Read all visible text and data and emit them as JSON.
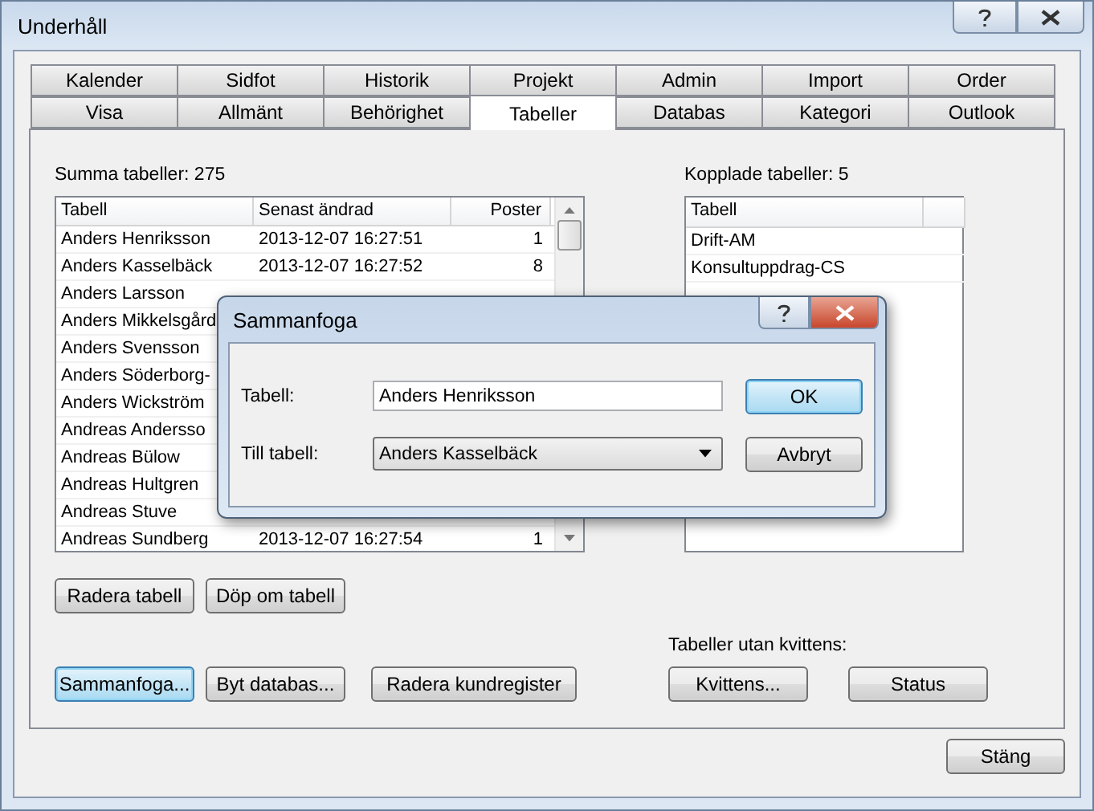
{
  "window": {
    "title": "Underhåll"
  },
  "tab_rows": [
    [
      {
        "label": "Kalender",
        "selected": false
      },
      {
        "label": "Sidfot",
        "selected": false
      },
      {
        "label": "Historik",
        "selected": false
      },
      {
        "label": "Projekt",
        "selected": false
      },
      {
        "label": "Admin",
        "selected": false
      },
      {
        "label": "Import",
        "selected": false
      },
      {
        "label": "Order",
        "selected": false
      }
    ],
    [
      {
        "label": "Visa",
        "selected": false
      },
      {
        "label": "Allmänt",
        "selected": false
      },
      {
        "label": "Behörighet",
        "selected": false
      },
      {
        "label": "Tabeller",
        "selected": true
      },
      {
        "label": "Databas",
        "selected": false
      },
      {
        "label": "Kategori",
        "selected": false
      },
      {
        "label": "Outlook",
        "selected": false
      }
    ]
  ],
  "tables": {
    "summary": "Summa tabeller: 275",
    "columns": [
      "Tabell",
      "Senast ändrad",
      "Poster"
    ],
    "rows": [
      {
        "name": "Anders Henriksson",
        "modified": "2013-12-07 16:27:51",
        "count": "1"
      },
      {
        "name": "Anders Kasselbäck",
        "modified": "2013-12-07 16:27:52",
        "count": "8"
      },
      {
        "name": "Anders Larsson"
      },
      {
        "name": "Anders Mikkelsgård"
      },
      {
        "name": "Anders Svensson"
      },
      {
        "name": "Anders Söderborg-"
      },
      {
        "name": "Anders Wickström"
      },
      {
        "name": "Andreas Andersso"
      },
      {
        "name": "Andreas Bülow"
      },
      {
        "name": "Andreas Hultgren"
      },
      {
        "name": "Andreas Stuve"
      },
      {
        "name": "Andreas Sundberg",
        "modified": "2013-12-07 16:27:54",
        "count": "1"
      }
    ]
  },
  "linked": {
    "summary": "Kopplade tabeller: 5",
    "columns": [
      "Tabell"
    ],
    "rows": [
      "Drift-AM",
      "Konsultuppdrag-CS"
    ]
  },
  "button_rows": [
    [
      {
        "label": "Radera tabell",
        "focused": false
      },
      {
        "label": "Döp om tabell",
        "focused": false
      }
    ],
    [
      {
        "label": "Sammanfoga...",
        "focused": true
      },
      {
        "label": "Byt databas...",
        "focused": false
      },
      {
        "label": "Radera kundregister",
        "focused": false
      }
    ]
  ],
  "unreceipted": {
    "label": "Tabeller utan kvittens:",
    "buttons": [
      {
        "label": "Kvittens...",
        "focused": false
      },
      {
        "label": "Status",
        "focused": false
      }
    ]
  },
  "close_button": {
    "label": "Stäng",
    "focused": false
  },
  "dialog": {
    "title": "Sammanfoga",
    "table_label": "Tabell:",
    "table_value": "Anders Henriksson",
    "target_label": "Till tabell:",
    "target_value": "Anders Kasselbäck",
    "buttons": [
      {
        "label": "OK",
        "focused": true
      },
      {
        "label": "Avbryt",
        "focused": false
      }
    ]
  }
}
